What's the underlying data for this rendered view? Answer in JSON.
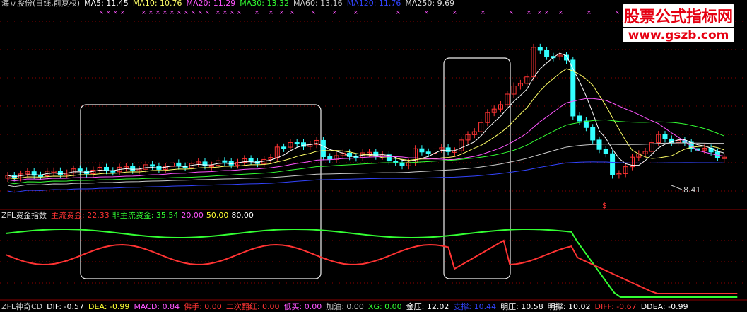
{
  "main_header": {
    "title": "海立股份(日线,前复权)",
    "ma": [
      {
        "label": "MA5: 11.45",
        "color": "#ffffff"
      },
      {
        "label": "MA10: 10.76",
        "color": "#ffff66"
      },
      {
        "label": "MA20: 11.29",
        "color": "#ff55ff"
      },
      {
        "label": "MA30: 13.32",
        "color": "#33ff33"
      },
      {
        "label": "MA60: 13.16",
        "color": "#cccccc"
      },
      {
        "label": "MA120: 11.76",
        "color": "#3344ff"
      },
      {
        "label": "MA250: 9.69",
        "color": "#dddddd"
      }
    ]
  },
  "brand": {
    "cn": "股票公式指标网",
    "url": "www.gszb.com"
  },
  "low_marker": "8.41",
  "panel_marker": "$",
  "indicator_header": {
    "name": "ZFL资金指数",
    "items": [
      {
        "label": "主流资金: 22.33",
        "color": "#ff3333"
      },
      {
        "label": "非主流资金: 35.54",
        "color": "#33ff33"
      },
      {
        "label": "20.00",
        "color": "#ff55ff"
      },
      {
        "label": "50.00",
        "color": "#ffff33"
      },
      {
        "label": "80.00",
        "color": "#ffffff"
      }
    ]
  },
  "bottom_bar": [
    {
      "label": "ZFL神奇CD",
      "color": "#cccccc"
    },
    {
      "label": "DIF: -0.57",
      "color": "#ffffff"
    },
    {
      "label": "DEA: -0.99",
      "color": "#ffff33"
    },
    {
      "label": "MACD: 0.84",
      "color": "#ff55ff"
    },
    {
      "label": "佛手: 0.00",
      "color": "#ff3333"
    },
    {
      "label": "二次翻红: 0.00",
      "color": "#ff3333"
    },
    {
      "label": "低买: 0.00",
      "color": "#ff55ff"
    },
    {
      "label": "加油: 0.00",
      "color": "#cccccc"
    },
    {
      "label": "XG: 0.00",
      "color": "#33ff33"
    },
    {
      "label": "金压: 12.02",
      "color": "#ffffff"
    },
    {
      "label": "支撑: 10.44",
      "color": "#3344ff"
    },
    {
      "label": "明压: 10.58",
      "color": "#ffffff"
    },
    {
      "label": "明撑: 10.02",
      "color": "#ffffff"
    },
    {
      "label": "DIFF: -0.67",
      "color": "#ff3333"
    },
    {
      "label": "DDEA: -0.99",
      "color": "#ffffff"
    }
  ],
  "colors": {
    "up": "#ff3333",
    "down": "#33ffff",
    "grid": "#8b0000"
  }
}
